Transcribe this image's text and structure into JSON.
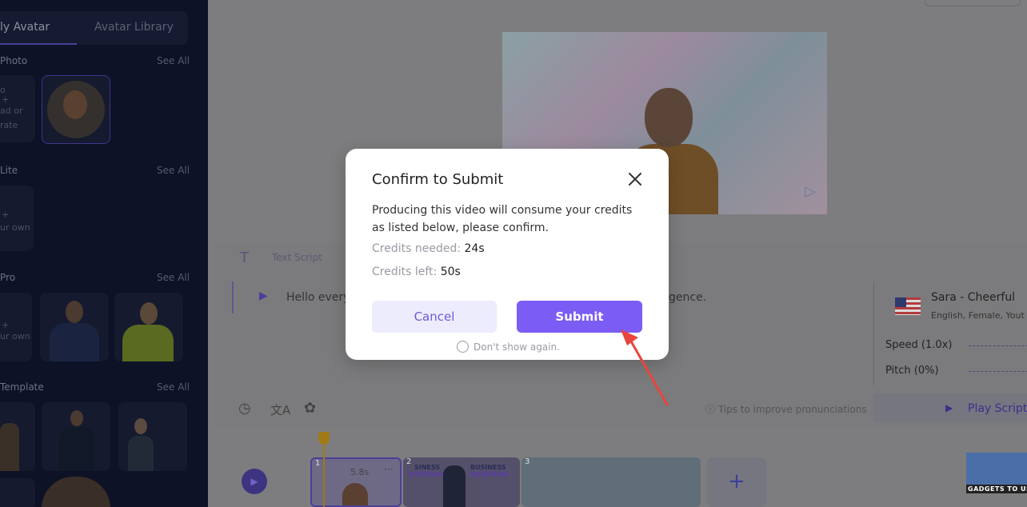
{
  "sidebar": {
    "tabs": [
      "ly Avatar",
      "Avatar Library"
    ],
    "sections": [
      {
        "title": "Photo",
        "see_all": "See All"
      },
      {
        "title": "Lite",
        "see_all": "See All"
      },
      {
        "title": "Pro",
        "see_all": "See All"
      },
      {
        "title": "Template",
        "see_all": "See All"
      }
    ],
    "upload_tile_text": [
      "o",
      "+",
      "ad or",
      "rate"
    ],
    "lite_tile_text": [
      "+",
      "ur own"
    ],
    "pro_tile_text": [
      "+",
      "ur own"
    ]
  },
  "preview": {
    "watermark_icon": "play-logo-icon"
  },
  "script": {
    "tab_label": "Text Script",
    "text_start": "Hello every",
    "text_end": "gence.",
    "tips": "Tips to improve pronunciations",
    "play_script": "Play Script"
  },
  "voice": {
    "name": "Sara - Cheerful",
    "meta": "English, Female, Yout",
    "speed": "Speed (1.0x)",
    "pitch": "Pitch (0%)"
  },
  "timeline": {
    "clips": [
      {
        "num": "1",
        "duration": "5.8s",
        "menu": "···"
      },
      {
        "num": "2",
        "title_a": "SINESS",
        "title_b": "WEBINAR",
        "title_c": "BUSINESS",
        "title_d": "WEBINAR"
      },
      {
        "num": "3"
      }
    ],
    "add_label": "+"
  },
  "watermark": {
    "text": "GADGETS TO USE"
  },
  "modal": {
    "title": "Confirm to Submit",
    "description": "Producing this video will consume your credits as listed below, please confirm.",
    "credits_needed_label": "Credits needed:",
    "credits_needed_value": "24s",
    "credits_left_label": "Credits left:",
    "credits_left_value": "50s",
    "cancel_label": "Cancel",
    "submit_label": "Submit",
    "dont_show_label": "Don't show again."
  },
  "colors": {
    "accent": "#7b5cf4",
    "cancel_bg": "#ececfd",
    "arrow": "#e8453c"
  }
}
